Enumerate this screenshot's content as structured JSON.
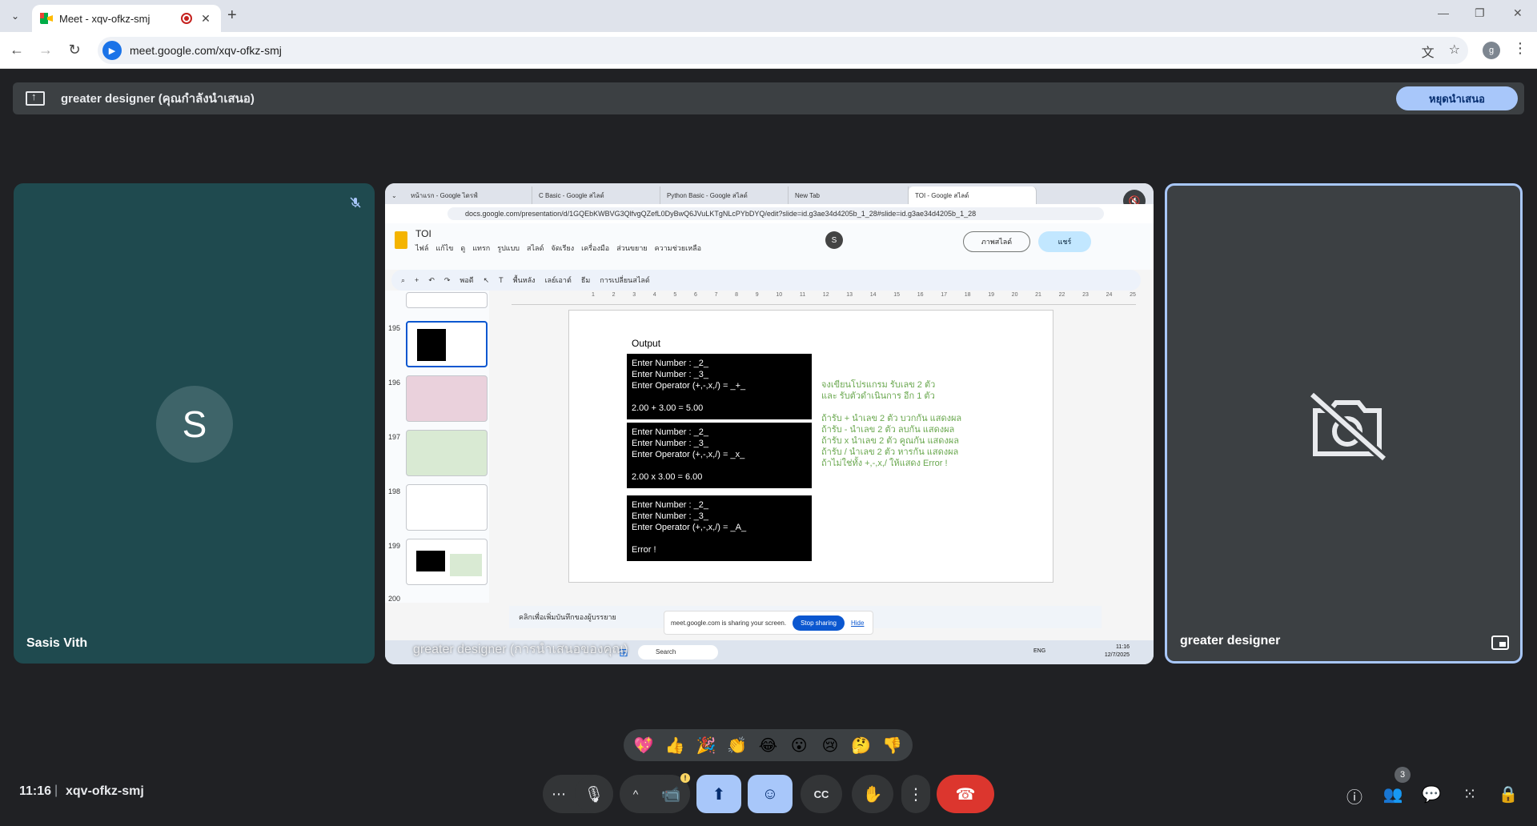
{
  "browser": {
    "tab_title": "Meet - xqv-ofkz-smj",
    "url": "meet.google.com/xqv-ofkz-smj",
    "new_tab_glyph": "+",
    "close_glyph": "✕",
    "menu_glyph": "⌄",
    "back_glyph": "←",
    "forward_glyph": "→",
    "reload_glyph": "↻",
    "minimize_glyph": "—",
    "restore_glyph": "❐",
    "window_close_glyph": "✕",
    "translate_glyph": "文",
    "star_glyph": "☆",
    "profile_initial": "g",
    "kebab_glyph": "⋮"
  },
  "banner": {
    "text": "greater designer (คุณกำลังนำเสนอ)",
    "stop_label": "หยุดนำเสนอ"
  },
  "participants": {
    "left": {
      "name": "Sasis Vith",
      "initial": "S",
      "tile_color": "#1f4a4f"
    },
    "right": {
      "name": "greater designer"
    }
  },
  "shared_screen": {
    "overlay_name": "greater designer (การนำเสนอของคุณ)",
    "tabs": [
      {
        "label": "หน้าแรก - Google ไดรฟ์"
      },
      {
        "label": "C Basic - Google สไลด์"
      },
      {
        "label": "Python Basic - Google สไลด์"
      },
      {
        "label": "New Tab"
      },
      {
        "label": "TOI - Google สไลด์"
      }
    ],
    "url": "docs.google.com/presentation/d/1GQEbKWBVG3QlfvgQZefL0DyBwQ6JVuLKTgNLcPYbDYQ/edit?slide=id.g3ae34d4205b_1_28#slide=id.g3ae34d4205b_1_28",
    "doc_title": "TOI",
    "menu": [
      "ไฟล์",
      "แก้ไข",
      "ดู",
      "แทรก",
      "รูปแบบ",
      "สไลด์",
      "จัดเรียง",
      "เครื่องมือ",
      "ส่วนขยาย",
      "ความช่วยเหลือ"
    ],
    "slideshow_label": "ภาพสไลด์",
    "share_label": "แชร์",
    "account_initial": "S",
    "toolbar": {
      "zoom": "พอดี",
      "background": "พื้นหลัง",
      "layout": "เลย์เอาต์",
      "theme": "ธีม",
      "transition": "การเปลี่ยนสไลด์"
    },
    "ruler_ticks": [
      "1",
      "2",
      "3",
      "4",
      "5",
      "6",
      "7",
      "8",
      "9",
      "10",
      "11",
      "12",
      "13",
      "14",
      "15",
      "16",
      "17",
      "18",
      "19",
      "20",
      "21",
      "22",
      "23",
      "24",
      "25"
    ],
    "thumbnails": [
      {
        "num": "195"
      },
      {
        "num": "196"
      },
      {
        "num": "197"
      },
      {
        "num": "198"
      },
      {
        "num": "199"
      },
      {
        "num": "200"
      }
    ],
    "slide": {
      "output_label": "Output",
      "terminals": [
        "Enter Number : _2_\nEnter Number : _3_\nEnter Operator (+,-,x,/) = _+_\n\n2.00 + 3.00 = 5.00",
        "Enter Number : _2_\nEnter Number : _3_\nEnter Operator (+,-,x,/) = _x_\n\n2.00 x 3.00 = 6.00",
        "Enter Number : _2_\nEnter Number : _3_\nEnter Operator (+,-,x,/) = _A_\n\nError !"
      ],
      "instruction_1": "จงเขียนโปรแกรม รับเลข 2 ตัว\nและ รับตัวดำเนินการ อีก 1 ตัว",
      "instruction_2": "ถ้ารับ + นำเลข 2 ตัว บวกกัน แสดงผล\nถ้ารับ - นำเลข 2 ตัว ลบกัน แสดงผล\nถ้ารับ x นำเลข 2 ตัว คูณกัน แสดงผล\nถ้ารับ / นำเลข 2 ตัว หารกัน แสดงผล\nถ้าไม่ใช่ทั้ง +,-,x,/ ให้แสดง Error !"
    },
    "notes_placeholder": "คลิกเพื่อเพิ่มบันทึกของผู้บรรยาย",
    "sharing": {
      "message": "meet.google.com is sharing your screen.",
      "stop_label": "Stop sharing",
      "hide_label": "Hide"
    },
    "taskbar": {
      "search_label": "Search",
      "lang": "ENG",
      "time": "11:16",
      "date": "12/7/2025"
    }
  },
  "reactions": [
    "💖",
    "👍",
    "🎉",
    "👏",
    "😂",
    "😮",
    "😢",
    "🤔",
    "👎"
  ],
  "bottom": {
    "time": "11:16",
    "separator": "|",
    "code": "xqv-ofkz-smj",
    "people_count": "3",
    "warn_glyph": "!",
    "icons": {
      "more_options": "⋯",
      "mic": "🎙",
      "chevron_up": "^",
      "camera": "📹",
      "present": "⬆",
      "emoji": "☺",
      "captions": "CC",
      "hand": "✋",
      "more_vert": "⋮",
      "end_call": "☎",
      "info": "ⓘ",
      "people": "👥",
      "chat": "💬",
      "activities": "⁙",
      "host_controls": "🔒"
    }
  }
}
